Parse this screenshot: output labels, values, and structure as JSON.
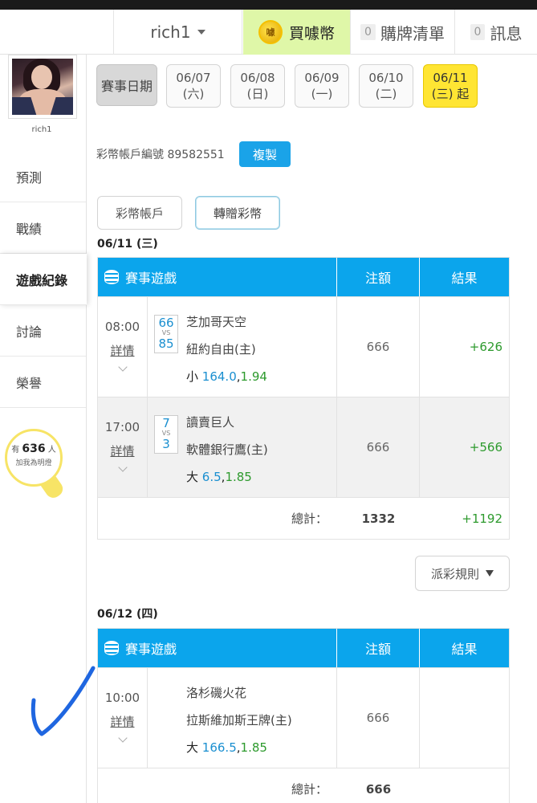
{
  "nav": {
    "username": "rich1",
    "buy_coins": "買噱幣",
    "coin_glyph": "噱",
    "cart_count": "0",
    "cart_label": "購牌清單",
    "msg_count": "0",
    "msg_label": "訊息"
  },
  "sidebar": {
    "username": "rich1",
    "items": [
      {
        "label": "預測"
      },
      {
        "label": "戰績"
      },
      {
        "label": "遊戲紀錄"
      },
      {
        "label": "討論"
      },
      {
        "label": "榮譽"
      }
    ],
    "bulb": {
      "prefix": "有",
      "count": "636",
      "suffix": "人",
      "line2": "加我為明燈"
    }
  },
  "dates": {
    "label": "賽事日期",
    "items": [
      {
        "date": "06/07",
        "day": "(六)"
      },
      {
        "date": "06/08",
        "day": "(日)"
      },
      {
        "date": "06/09",
        "day": "(一)"
      },
      {
        "date": "06/10",
        "day": "(二)"
      },
      {
        "date": "06/11",
        "day": "(三) 起"
      }
    ]
  },
  "account": {
    "text": "彩幣帳戶編號 89582551",
    "copy": "複製",
    "tab1": "彩幣帳戶",
    "tab2": "轉贈彩幣"
  },
  "header": {
    "game": "賽事遊戲",
    "bet": "注額",
    "result": "結果"
  },
  "day1": {
    "title": "06/11 (三)",
    "rows": [
      {
        "time": "08:00",
        "detail": "詳情",
        "s1": "66",
        "vs": "VS",
        "s2": "85",
        "team1": "芝加哥天空",
        "team2": "紐約自由(主)",
        "pick_prefix": "小",
        "pick_v1": "164.0",
        "pick_sep": ",",
        "pick_v2": "1.94",
        "bet": "666",
        "result": "+626"
      },
      {
        "time": "17:00",
        "detail": "詳情",
        "s1": "7",
        "vs": "VS",
        "s2": "3",
        "team1": "讀賣巨人",
        "team2": "軟體銀行鷹(主)",
        "pick_prefix": "大",
        "pick_v1": "6.5",
        "pick_sep": ",",
        "pick_v2": "1.85",
        "bet": "666",
        "result": "+566"
      }
    ],
    "total_label": "總計：",
    "total_bet": "1332",
    "total_result": "+1192"
  },
  "rules": "派彩規則",
  "day2": {
    "title": "06/12 (四)",
    "rows": [
      {
        "time": "10:00",
        "detail": "詳情",
        "team1": "洛杉磯火花",
        "team2": "拉斯維加斯王牌(主)",
        "pick_prefix": "大",
        "pick_v1": "166.5",
        "pick_sep": ",",
        "pick_v2": "1.85",
        "bet": "666",
        "result": ""
      }
    ],
    "total_label": "總計：",
    "total_bet": "666"
  }
}
